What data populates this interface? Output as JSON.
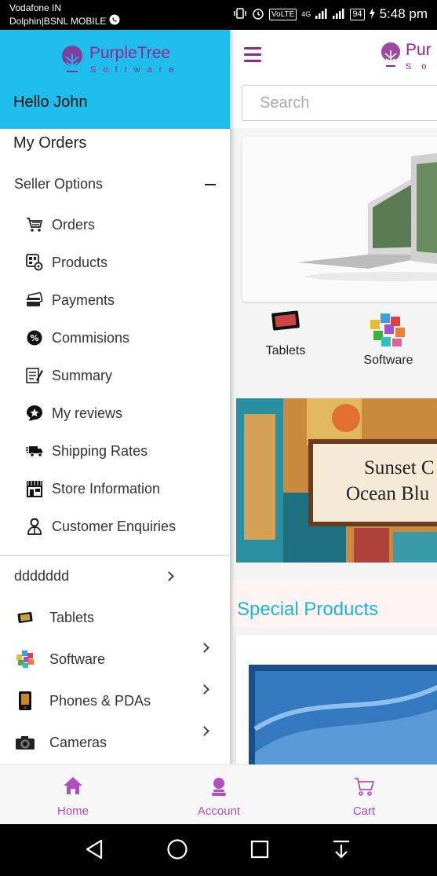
{
  "status_bar": {
    "carrier_1": "Vodafone IN",
    "carrier_2": "Dolphin|BSNL MOBILE",
    "volte": "VoLTE",
    "network": "4G",
    "battery": "94",
    "time": "5:48 pm"
  },
  "brand": {
    "name": "PurpleTree",
    "tagline": "Software",
    "name_clipped": "Pur",
    "tagline_clipped": "S o f"
  },
  "drawer": {
    "greeting": "Hello John",
    "my_orders": "My Orders",
    "seller_options": "Seller Options",
    "seller_items": [
      {
        "label": "Orders",
        "icon": "cart-icon"
      },
      {
        "label": "Products",
        "icon": "products-icon"
      },
      {
        "label": "Payments",
        "icon": "payments-icon"
      },
      {
        "label": "Commisions",
        "icon": "percent-icon"
      },
      {
        "label": "Summary",
        "icon": "summary-icon"
      },
      {
        "label": "My reviews",
        "icon": "reviews-icon"
      },
      {
        "label": "Shipping Rates",
        "icon": "truck-icon"
      },
      {
        "label": "Store Information",
        "icon": "store-icon"
      },
      {
        "label": "Customer Enquiries",
        "icon": "customer-icon"
      }
    ],
    "category_header": "ddddddd",
    "categories": [
      {
        "label": "Tablets",
        "icon": "tablet-icon"
      },
      {
        "label": "Software",
        "icon": "software-icon"
      },
      {
        "label": "Phones & PDAs",
        "icon": "phone-icon"
      },
      {
        "label": "Cameras",
        "icon": "camera-icon"
      }
    ]
  },
  "main": {
    "search_placeholder": "Search",
    "categories": [
      {
        "label": "Tablets"
      },
      {
        "label": "Software"
      }
    ],
    "promo_text_1": "Sunset C",
    "promo_text_2": "Ocean Blu",
    "special_title": "Special Products"
  },
  "bottom_nav": {
    "home": "Home",
    "account": "Account",
    "cart": "Cart",
    "accent_color": "#b04fbf"
  },
  "colors": {
    "drawer_header": "#1ebdec",
    "brand_purple": "#8e2a8e",
    "special_title": "#1ab5d8"
  }
}
